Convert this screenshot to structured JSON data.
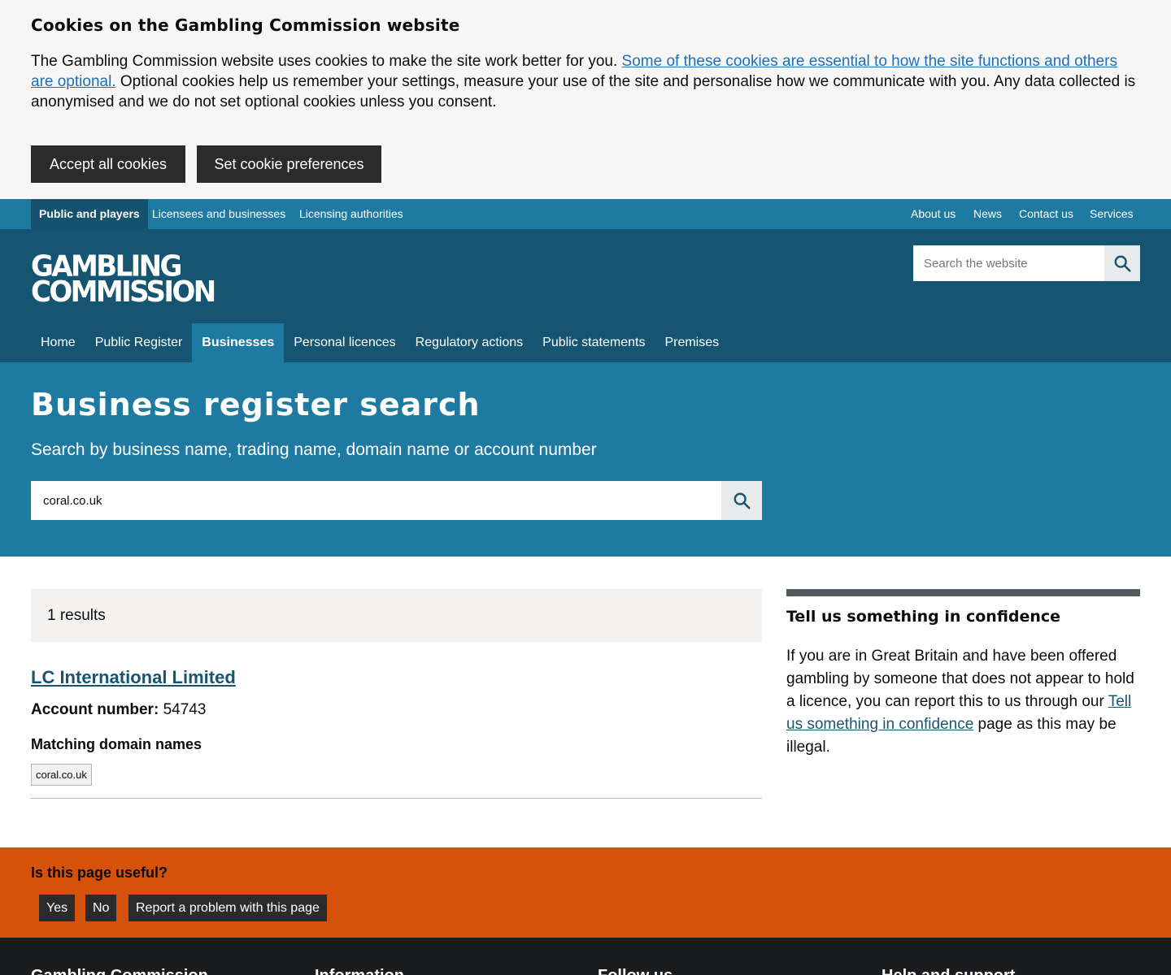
{
  "cookie_banner": {
    "title": "Cookies on the Gambling Commission website",
    "text_before": "The Gambling Commission website uses cookies to make the site work better for you. ",
    "link": "Some of these cookies are essential to how the site functions and others are optional.",
    "text_after": " Optional cookies help us remember your settings, measure your use of the site and personalise how we communicate with you. Any data collected is anonymised and we do not set optional cookies unless you consent.",
    "accept_label": "Accept all cookies",
    "prefs_label": "Set cookie preferences"
  },
  "audience_nav": [
    {
      "label": "Public and players",
      "active": true
    },
    {
      "label": "Licensees and businesses",
      "active": false
    },
    {
      "label": "Licensing authorities",
      "active": false
    }
  ],
  "utility_nav": [
    "About us",
    "News",
    "Contact us",
    "Services"
  ],
  "header": {
    "logo_line1": "GAMBLING",
    "logo_line2": "COMMISSION",
    "search_placeholder": "Search the website"
  },
  "main_nav": [
    {
      "label": "Home",
      "active": false
    },
    {
      "label": "Public Register",
      "active": false
    },
    {
      "label": "Businesses",
      "active": true
    },
    {
      "label": "Personal licences",
      "active": false
    },
    {
      "label": "Regulatory actions",
      "active": false
    },
    {
      "label": "Public statements",
      "active": false
    },
    {
      "label": "Premises",
      "active": false
    }
  ],
  "hero": {
    "title": "Business register search",
    "lead": "Search by business name, trading name, domain name or account number",
    "search_value": "coral.co.uk"
  },
  "results": {
    "count_text": "1 results",
    "items": [
      {
        "name": "LC International Limited",
        "account_label": "Account number:",
        "account_number": "54743",
        "matching_heading": "Matching domain names",
        "domains": [
          "coral.co.uk"
        ]
      }
    ]
  },
  "sidebar": {
    "title": "Tell us something in confidence",
    "text_before": "If you are in Great Britain and have been offered gambling by someone that does not appear to hold a licence, you can report this to us through our ",
    "link": "Tell us something in confidence",
    "text_after": " page as this may be illegal."
  },
  "feedback": {
    "question": "Is this page useful?",
    "yes": "Yes",
    "no": "No",
    "report": "Report a problem with this page"
  },
  "footer": {
    "headings": [
      "Gambling Commission",
      "Information",
      "Follow us",
      "Help and support"
    ]
  },
  "colors": {
    "audience_bar": "#1e7aa0",
    "header": "#165572",
    "hero": "#1e7aa0",
    "feedback": "#d4520b",
    "footer": "#1b1c1e"
  }
}
